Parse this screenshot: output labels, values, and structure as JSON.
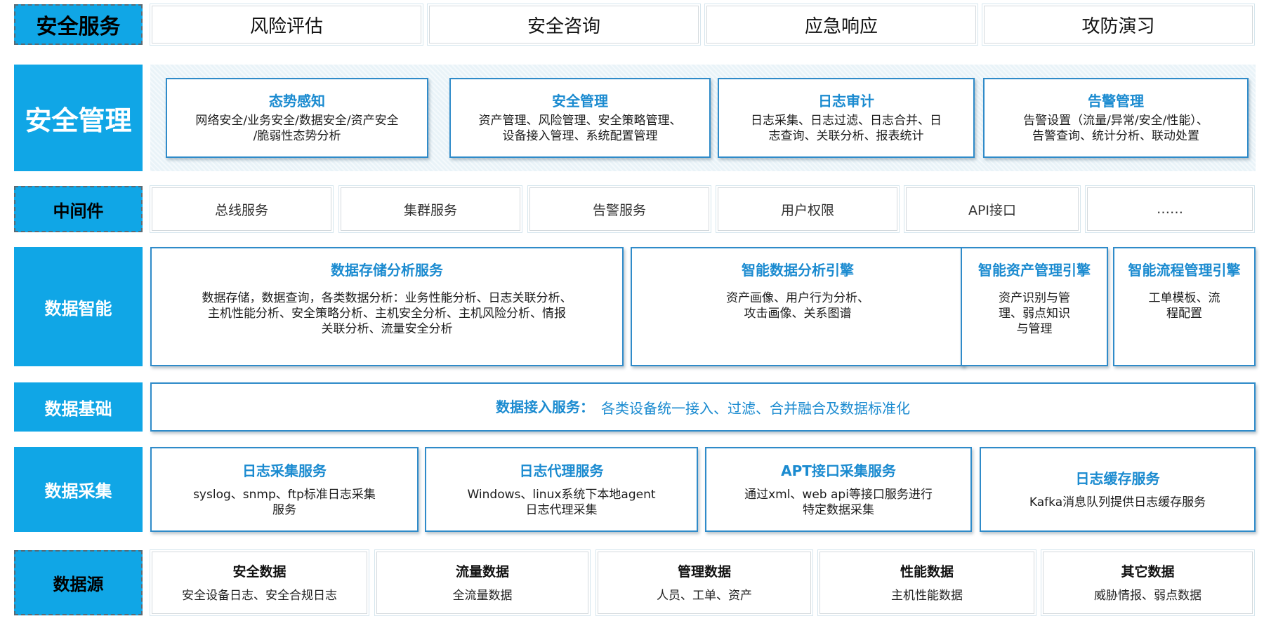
{
  "rows": {
    "service": {
      "label": "安全服务",
      "items": [
        "风险评估",
        "安全咨询",
        "应急响应",
        "攻防演习"
      ]
    },
    "management": {
      "label": "安全管理",
      "items": [
        {
          "title": "态势感知",
          "desc": "网络安全/业务安全/数据安全/资产安全\n/脆弱性态势分析"
        },
        {
          "title": "安全管理",
          "desc": "资产管理、风险管理、安全策略管理、\n设备接入管理、系统配置管理"
        },
        {
          "title": "日志审计",
          "desc": "日志采集、日志过滤、日志合并、日\n志查询、关联分析、报表统计"
        },
        {
          "title": "告警管理",
          "desc": "告警设置（流量/异常/安全/性能）、\n告警查询、统计分析、联动处置"
        }
      ]
    },
    "middleware": {
      "label": "中间件",
      "items": [
        "总线服务",
        "集群服务",
        "告警服务",
        "用户权限",
        "API接口",
        "……"
      ]
    },
    "intelligence": {
      "label": "数据智能",
      "items": [
        {
          "title": "数据存储分析服务",
          "desc": "数据存储，数据查询，各类数据分析：业务性能分析、日志关联分析、\n主机性能分析、安全策略分析、主机安全分析、主机风险分析、情报\n关联分析、流量安全分析"
        },
        {
          "title": "智能数据分析引擎",
          "desc": "资产画像、用户行为分析、\n攻击画像、关系图谱"
        },
        {
          "title": "智能资产管理引擎",
          "desc": "资产识别与管\n理、弱点知识\n与管理"
        },
        {
          "title": "智能流程管理引擎",
          "desc": "工单模板、流\n程配置"
        }
      ]
    },
    "foundation": {
      "label": "数据基础",
      "title": "数据接入服务：",
      "desc": "各类设备统一接入、过滤、合并融合及数据标准化"
    },
    "collection": {
      "label": "数据采集",
      "items": [
        {
          "title": "日志采集服务",
          "desc": "syslog、snmp、ftp标准日志采集\n服务"
        },
        {
          "title": "日志代理服务",
          "desc": "Windows、linux系统下本地agent\n日志代理采集"
        },
        {
          "title": "APT接口采集服务",
          "desc": "通过xml、web api等接口服务进行\n特定数据采集"
        },
        {
          "title": "日志缓存服务",
          "desc": "Kafka消息队列提供日志缓存服务"
        }
      ]
    },
    "source": {
      "label": "数据源",
      "items": [
        {
          "title": "安全数据",
          "desc": "安全设备日志、安全合规日志"
        },
        {
          "title": "流量数据",
          "desc": "全流量数据"
        },
        {
          "title": "管理数据",
          "desc": "人员、工单、资产"
        },
        {
          "title": "性能数据",
          "desc": "主机性能数据"
        },
        {
          "title": "其它数据",
          "desc": "威胁情报、弱点数据"
        }
      ]
    }
  },
  "colors": {
    "label_bg": "#10a6e6",
    "accent": "#1b8bd0",
    "border": "#2f8bc9"
  }
}
